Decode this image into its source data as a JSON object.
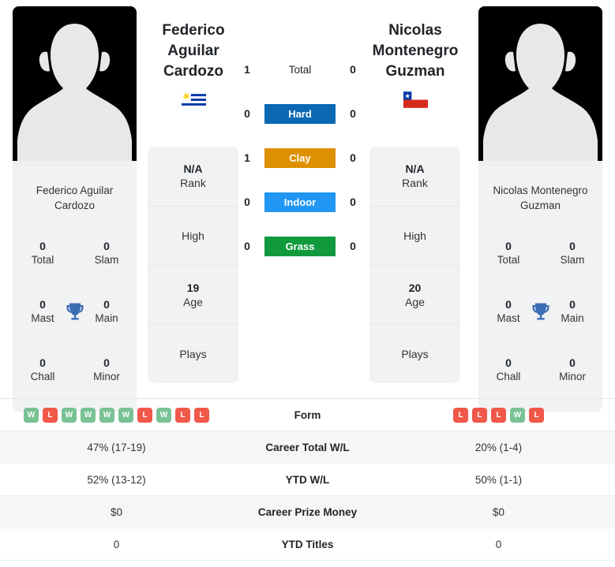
{
  "players": {
    "left": {
      "first_line": "Federico",
      "second_line": "Aguilar",
      "third_line": "Cardozo",
      "card_name": "Federico Aguilar Cardozo",
      "flag_name": "uruguay-flag",
      "flag_country": "Uruguay",
      "avatar_name": "player-avatar-placeholder",
      "rank_value": "N/A",
      "rank_label": "Rank",
      "high_value": "",
      "high_label": "High",
      "age_value": "19",
      "age_label": "Age",
      "plays_value": "",
      "plays_label": "Plays",
      "titles": [
        {
          "num": "0",
          "label": "Total"
        },
        {
          "num": "0",
          "label": "Slam"
        },
        {
          "num": "0",
          "label": "Mast"
        },
        {
          "num": "0",
          "label": "Main"
        },
        {
          "num": "0",
          "label": "Chall"
        },
        {
          "num": "0",
          "label": "Minor"
        }
      ]
    },
    "right": {
      "first_line": "Nicolas",
      "second_line": "Montenegro",
      "third_line": "Guzman",
      "card_name": "Nicolas Montenegro Guzman",
      "flag_name": "chile-flag",
      "flag_country": "Chile",
      "avatar_name": "player-avatar-placeholder",
      "rank_value": "N/A",
      "rank_label": "Rank",
      "high_value": "",
      "high_label": "High",
      "age_value": "20",
      "age_label": "Age",
      "plays_value": "",
      "plays_label": "Plays",
      "titles": [
        {
          "num": "0",
          "label": "Total"
        },
        {
          "num": "0",
          "label": "Slam"
        },
        {
          "num": "0",
          "label": "Mast"
        },
        {
          "num": "0",
          "label": "Main"
        },
        {
          "num": "0",
          "label": "Chall"
        },
        {
          "num": "0",
          "label": "Minor"
        }
      ]
    }
  },
  "h2h": {
    "rows": [
      {
        "left": "1",
        "label": "Total",
        "right": "0",
        "color": "transparent",
        "text_color": "#212529"
      },
      {
        "left": "0",
        "label": "Hard",
        "right": "0",
        "color": "#0b69b4",
        "text_color": "#ffffff"
      },
      {
        "left": "1",
        "label": "Clay",
        "right": "0",
        "color": "#dd9000",
        "text_color": "#ffffff"
      },
      {
        "left": "0",
        "label": "Indoor",
        "right": "0",
        "color": "#2196f3",
        "text_color": "#ffffff"
      },
      {
        "left": "0",
        "label": "Grass",
        "right": "0",
        "color": "#109a3d",
        "text_color": "#ffffff"
      }
    ]
  },
  "stats_table": {
    "rows": [
      {
        "label": "Form",
        "type": "form",
        "left_form": [
          "W",
          "L",
          "W",
          "W",
          "W",
          "W",
          "L",
          "W",
          "L",
          "L"
        ],
        "right_form": [
          "L",
          "L",
          "L",
          "W",
          "L"
        ],
        "left": "",
        "right": ""
      },
      {
        "label": "Career Total W/L",
        "type": "text",
        "left": "47% (17-19)",
        "right": "20% (1-4)"
      },
      {
        "label": "YTD W/L",
        "type": "text",
        "left": "52% (13-12)",
        "right": "50% (1-1)"
      },
      {
        "label": "Career Prize Money",
        "type": "text",
        "left": "$0",
        "right": "$0"
      },
      {
        "label": "YTD Titles",
        "type": "text",
        "left": "0",
        "right": "0"
      }
    ]
  },
  "colors": {
    "hard": "#0b69b4",
    "clay": "#dd9000",
    "indoor": "#2196f3",
    "grass": "#109a3d",
    "win_badge": "#7ac295",
    "loss_badge": "#f0584a",
    "card_bg": "#f1f2f3",
    "trophy": "#3c6eb4"
  }
}
